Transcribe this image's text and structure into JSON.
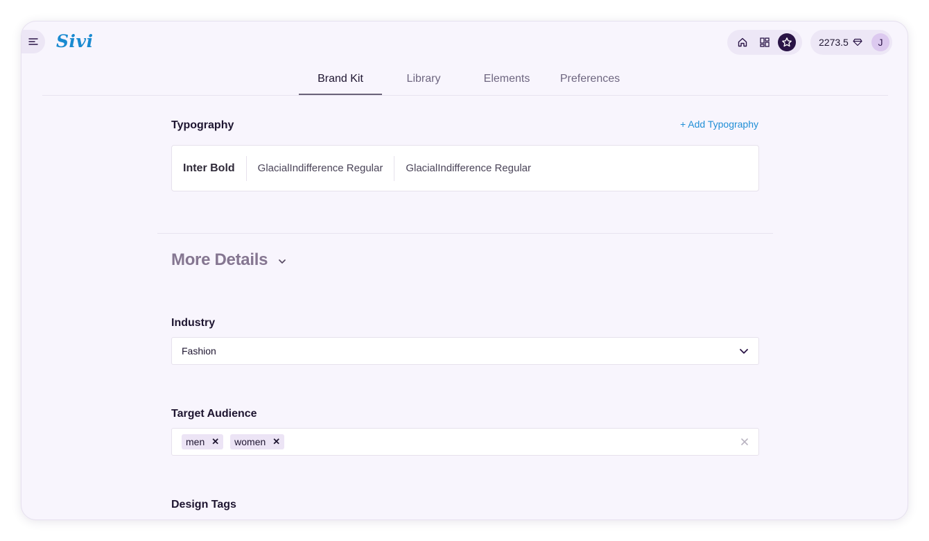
{
  "app": {
    "logo": "Sivi"
  },
  "header": {
    "credits": "2273.5",
    "avatar_initial": "J",
    "nav_icons": [
      "home-icon",
      "dashboard-icon",
      "star-icon"
    ]
  },
  "tabs": [
    {
      "label": "Brand Kit",
      "active": true
    },
    {
      "label": "Library",
      "active": false
    },
    {
      "label": "Elements",
      "active": false
    },
    {
      "label": "Preferences",
      "active": false
    }
  ],
  "typography": {
    "title": "Typography",
    "add_label": "+ Add Typography",
    "fonts": [
      "Inter Bold",
      "GlacialIndifference Regular",
      "GlacialIndifference Regular"
    ]
  },
  "more_details": {
    "label": "More Details"
  },
  "industry": {
    "label": "Industry",
    "value": "Fashion"
  },
  "target_audience": {
    "label": "Target Audience",
    "chips": [
      "men",
      "women"
    ]
  },
  "design_tags": {
    "label": "Design Tags"
  },
  "colors": {
    "accent": "#1f8ed6",
    "dark": "#2a1446",
    "background": "#f8f5fd"
  }
}
